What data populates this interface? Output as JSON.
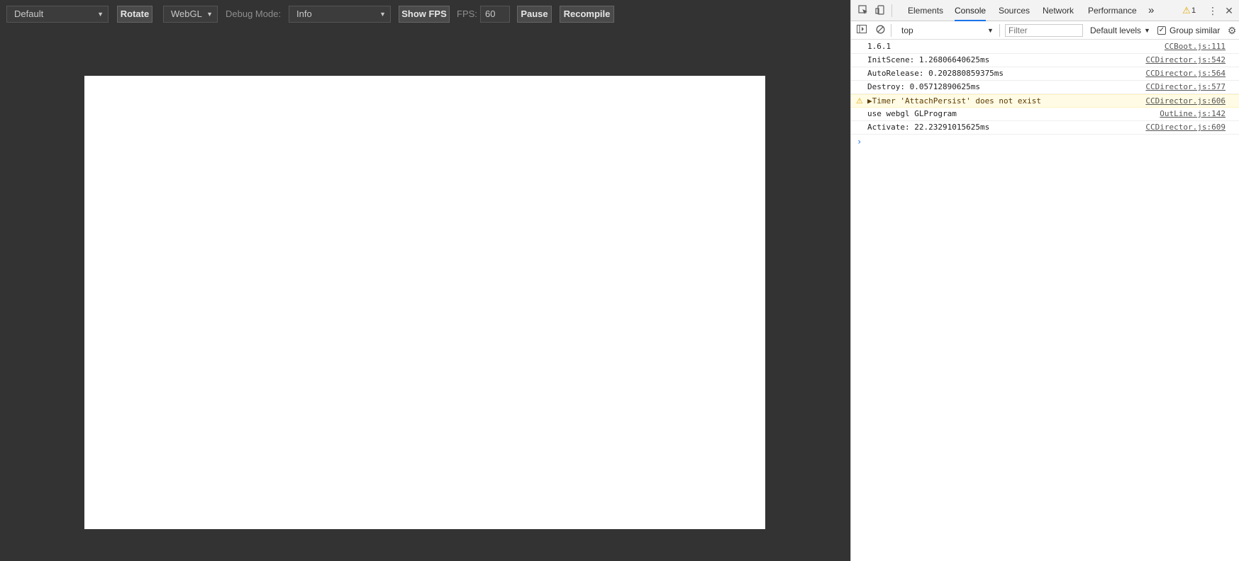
{
  "toolbar": {
    "orientation_select": "Default",
    "rotate_label": "Rotate",
    "renderer_select": "WebGL",
    "debug_mode_label": "Debug Mode:",
    "debug_mode_select": "Info",
    "show_fps_label": "Show FPS",
    "fps_label": "FPS:",
    "fps_value": "60",
    "pause_label": "Pause",
    "recompile_label": "Recompile"
  },
  "devtools": {
    "tabs": [
      "Elements",
      "Console",
      "Sources",
      "Network",
      "Performance"
    ],
    "active_tab": "Console",
    "more_tabs_glyph": "»",
    "warning_count": "1",
    "context_select": "top",
    "filter_placeholder": "Filter",
    "levels_select": "Default levels",
    "group_similar_label": "Group similar",
    "group_similar_checked": true
  },
  "console": {
    "rows": [
      {
        "msg": "1.6.1",
        "src": "CCBoot.js:111",
        "level": "log"
      },
      {
        "msg": "InitScene: 1.26806640625ms",
        "src": "CCDirector.js:542",
        "level": "log"
      },
      {
        "msg": "AutoRelease: 0.202880859375ms",
        "src": "CCDirector.js:564",
        "level": "log"
      },
      {
        "msg": "Destroy: 0.05712890625ms",
        "src": "CCDirector.js:577",
        "level": "log"
      },
      {
        "msg": "▶Timer 'AttachPersist' does not exist",
        "src": "CCDirector.js:606",
        "level": "warn"
      },
      {
        "msg": "use webgl GLProgram",
        "src": "OutLine.js:142",
        "level": "log"
      },
      {
        "msg": "Activate: 22.23291015625ms",
        "src": "CCDirector.js:609",
        "level": "log"
      }
    ],
    "prompt_glyph": "›"
  },
  "colors": {
    "preview_bg": "#333333",
    "canvas_bg": "#ffffff",
    "accent": "#1a73e8",
    "warning": "#e0a800"
  }
}
